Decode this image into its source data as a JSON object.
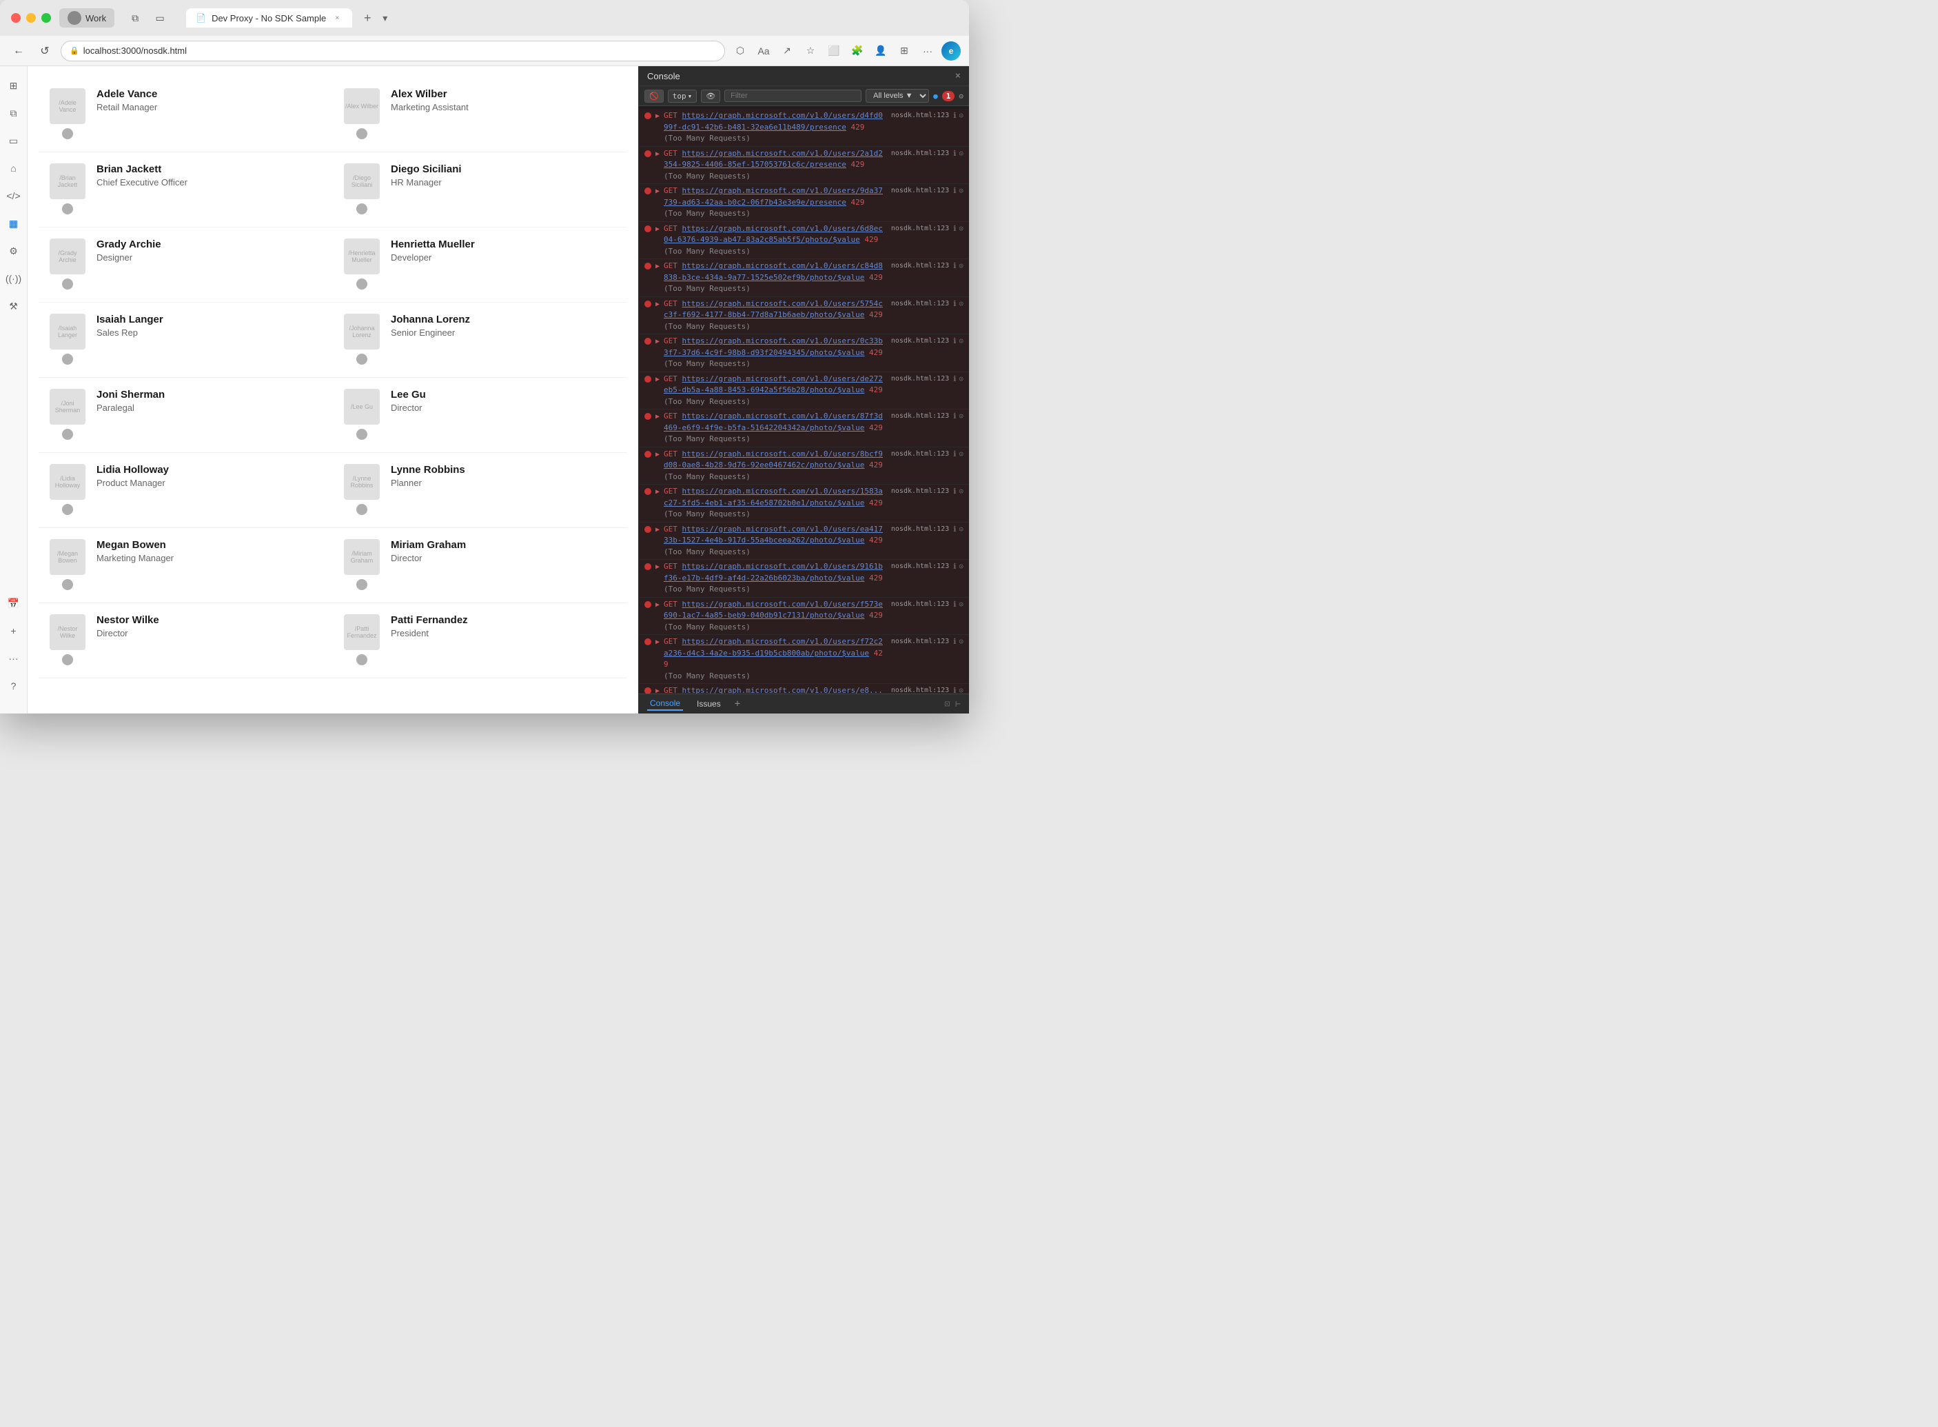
{
  "browser": {
    "traffic_lights": [
      "red",
      "yellow",
      "green"
    ],
    "profile_tab_label": "Work",
    "tab_title": "Dev Proxy - No SDK Sample",
    "tab_close_label": "×",
    "new_tab_label": "+",
    "url": "localhost:3000/nosdk.html",
    "nav_back": "←",
    "nav_refresh": "↺",
    "nav_forward": "→"
  },
  "toolbar_icons": [
    "grid-view",
    "copy",
    "window",
    "back-arrow",
    "code",
    "table",
    "settings",
    "wifi",
    "tools",
    "calendar",
    "add"
  ],
  "people": [
    {
      "name": "Adele Vance",
      "title": "Retail Manager",
      "avatar_text": "/Adele Vance"
    },
    {
      "name": "Alex Wilber",
      "title": "Marketing Assistant",
      "avatar_text": "/Alex Wilber"
    },
    {
      "name": "Brian Jackett",
      "title": "Chief Executive Officer",
      "avatar_text": "/Brian Jackett"
    },
    {
      "name": "Diego Siciliani",
      "title": "HR Manager",
      "avatar_text": "/Diego Siciliani"
    },
    {
      "name": "Grady Archie",
      "title": "Designer",
      "avatar_text": "/Grady Archie"
    },
    {
      "name": "Henrietta Mueller",
      "title": "Developer",
      "avatar_text": "/Henrietta Mueller"
    },
    {
      "name": "Isaiah Langer",
      "title": "Sales Rep",
      "avatar_text": "/Isaiah Langer"
    },
    {
      "name": "Johanna Lorenz",
      "title": "Senior Engineer",
      "avatar_text": "/Johanna Lorenz"
    },
    {
      "name": "Joni Sherman",
      "title": "Paralegal",
      "avatar_text": "/Joni Sherman"
    },
    {
      "name": "Lee Gu",
      "title": "Director",
      "avatar_text": "/Lee Gu"
    },
    {
      "name": "Lidia Holloway",
      "title": "Product Manager",
      "avatar_text": "/Lidia Holloway"
    },
    {
      "name": "Lynne Robbins",
      "title": "Planner",
      "avatar_text": "/Lynne Robbins"
    },
    {
      "name": "Megan Bowen",
      "title": "Marketing Manager",
      "avatar_text": "/Megan Bowen"
    },
    {
      "name": "Miriam Graham",
      "title": "Director",
      "avatar_text": "/Miriam Graham"
    },
    {
      "name": "Nestor Wilke",
      "title": "Director",
      "avatar_text": "/Nestor Wilke"
    },
    {
      "name": "Patti Fernandez",
      "title": "President",
      "avatar_text": "/Patti Fernandez"
    }
  ],
  "console": {
    "title": "Console",
    "close_label": "×",
    "filter_placeholder": "Filter",
    "top_label": "top",
    "all_levels_label": "All levels ▼",
    "error_count": "1",
    "messages": [
      {
        "type": "error",
        "triangle": "▶",
        "content_prefix": "GET ",
        "url": "https://graph.microsoft.com/v1.0/users/d4fd099f-dc91-42b6-b481-32ea6e11b489/presence",
        "status": " 429",
        "detail": "(Too Many Requests)",
        "file_ref": "nosdk.html:123"
      },
      {
        "type": "error",
        "triangle": "▶",
        "content_prefix": "GET ",
        "url": "https://graph.microsoft.com/v1.0/users/2a1d2354-9825-4406-85ef-157053761c6c/presence",
        "status": " 429",
        "detail": "(Too Many Requests)",
        "file_ref": "nosdk.html:123"
      },
      {
        "type": "error",
        "triangle": "▶",
        "content_prefix": "GET ",
        "url": "https://graph.microsoft.com/v1.0/users/9da37739-ad63-42aa-b0c2-06f7b43e3e9e/presence",
        "status": " 429",
        "detail": "(Too Many Requests)",
        "file_ref": "nosdk.html:123"
      },
      {
        "type": "error",
        "triangle": "▶",
        "content_prefix": "GET ",
        "url": "https://graph.microsoft.com/v1.0/users/6d8ec04-6376-4939-ab47-83a2c85ab5f5/photo/$value",
        "status": " 429",
        "detail": "(Too Many Requests)",
        "file_ref": "nosdk.html:123"
      },
      {
        "type": "error",
        "triangle": "▶",
        "content_prefix": "GET ",
        "url": "https://graph.microsoft.com/v1.0/users/c84d8838-b3ce-434a-9a77-1525e502ef9b/photo/$value",
        "status": " 429",
        "detail": "(Too Many Requests)",
        "file_ref": "nosdk.html:123"
      },
      {
        "type": "error",
        "triangle": "▶",
        "content_prefix": "GET ",
        "url": "https://graph.microsoft.com/v1.0/users/5754cc3f-f692-4177-8bb4-77d8a71b6aeb/photo/$value",
        "status": " 429",
        "detail": "(Too Many Requests)",
        "file_ref": "nosdk.html:123"
      },
      {
        "type": "error",
        "triangle": "▶",
        "content_prefix": "GET ",
        "url": "https://graph.microsoft.com/v1.0/users/0c33b3f7-37d6-4c9f-98b8-d93f20494345/photo/$value",
        "status": " 429",
        "detail": "(Too Many Requests)",
        "file_ref": "nosdk.html:123"
      },
      {
        "type": "error",
        "triangle": "▶",
        "content_prefix": "GET ",
        "url": "https://graph.microsoft.com/v1.0/users/de272eb5-db5a-4a88-8453-6942a5f56b28/photo/$value",
        "status": " 429",
        "detail": "(Too Many Requests)",
        "file_ref": "nosdk.html:123"
      },
      {
        "type": "error",
        "triangle": "▶",
        "content_prefix": "GET ",
        "url": "https://graph.microsoft.com/v1.0/users/87f3d469-e6f9-4f9e-b5fa-51642204342a/photo/$value",
        "status": " 429",
        "detail": "(Too Many Requests)",
        "file_ref": "nosdk.html:123"
      },
      {
        "type": "error",
        "triangle": "▶",
        "content_prefix": "GET ",
        "url": "https://graph.microsoft.com/v1.0/users/8bcf9d08-0ae8-4b28-9d76-92ee0467462c/photo/$value",
        "status": " 429",
        "detail": "(Too Many Requests)",
        "file_ref": "nosdk.html:123"
      },
      {
        "type": "error",
        "triangle": "▶",
        "content_prefix": "GET ",
        "url": "https://graph.microsoft.com/v1.0/users/1583ac27-5fd5-4eb1-af35-64e58702b0e1/photo/$value",
        "status": " 429",
        "detail": "(Too Many Requests)",
        "file_ref": "nosdk.html:123"
      },
      {
        "type": "error",
        "triangle": "▶",
        "content_prefix": "GET ",
        "url": "https://graph.microsoft.com/v1.0/users/ea41733b-1527-4e4b-917d-55a4bceea262/photo/$value",
        "status": " 429",
        "detail": "(Too Many Requests)",
        "file_ref": "nosdk.html:123"
      },
      {
        "type": "error",
        "triangle": "▶",
        "content_prefix": "GET ",
        "url": "https://graph.microsoft.com/v1.0/users/9161bf36-e17b-4df9-af4d-22a26b6023ba/photo/$value",
        "status": " 429",
        "detail": "(Too Many Requests)",
        "file_ref": "nosdk.html:123"
      },
      {
        "type": "error",
        "triangle": "▶",
        "content_prefix": "GET ",
        "url": "https://graph.microsoft.com/v1.0/users/f573e690-1ac7-4a85-beb9-040db91c7131/photo/$value",
        "status": " 429",
        "detail": "(Too Many Requests)",
        "file_ref": "nosdk.html:123"
      },
      {
        "type": "error",
        "triangle": "▶",
        "content_prefix": "GET ",
        "url": "https://graph.microsoft.com/v1.0/users/f72c2a236-d4c3-4a2e-b935-d19b5cb800ab/photo/$value",
        "status": " 429",
        "detail": "(Too Many Requests)",
        "file_ref": "nosdk.html:123"
      },
      {
        "type": "error",
        "triangle": "▶",
        "content_prefix": "GET ",
        "url": "https://graph.microsoft.com/v1.0/users/e8...",
        "status": "",
        "detail": "",
        "file_ref": "nosdk.html:123"
      }
    ],
    "footer_tabs": [
      "Console",
      "Issues"
    ],
    "footer_add": "+"
  }
}
